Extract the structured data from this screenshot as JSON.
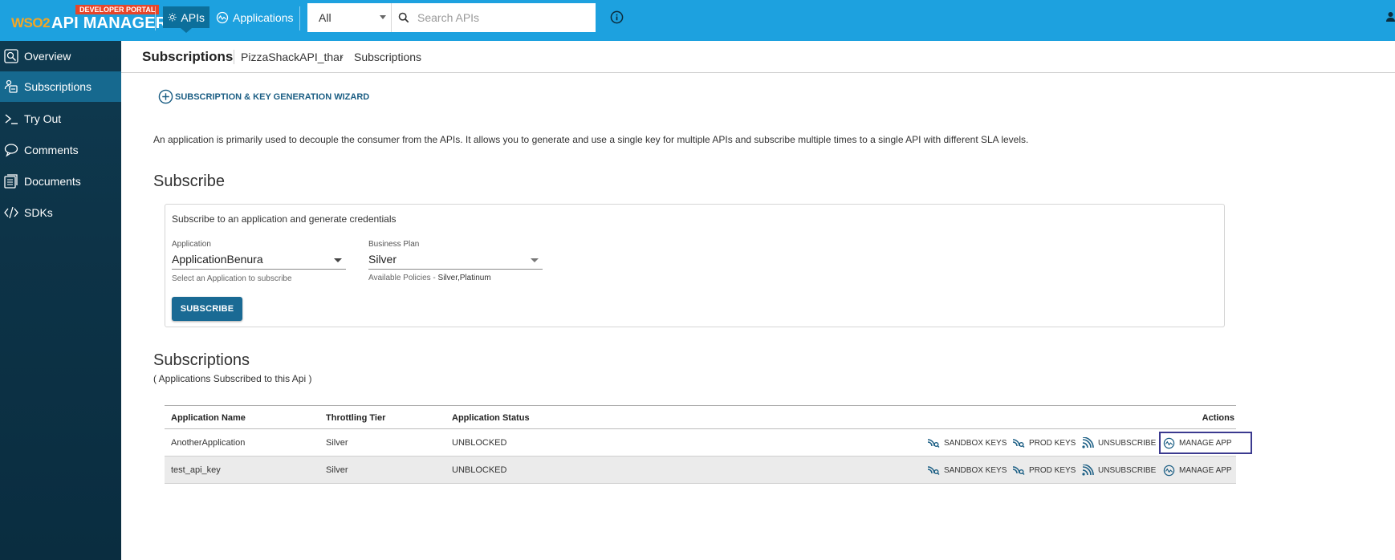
{
  "header": {
    "logo_prefix": "WSO2",
    "logo_title": "API MANAGER",
    "badge": "DEVELOPER PORTAL",
    "nav": [
      {
        "label": "APIs",
        "icon": "gear-icon",
        "active": true
      },
      {
        "label": "Applications",
        "icon": "applications-icon",
        "active": false
      }
    ],
    "search": {
      "scope": "All",
      "placeholder": "Search APIs"
    }
  },
  "sidebar": {
    "items": [
      {
        "label": "Overview",
        "icon": "overview-icon"
      },
      {
        "label": "Subscriptions",
        "icon": "subscriptions-icon",
        "active": true
      },
      {
        "label": "Try Out",
        "icon": "terminal-icon"
      },
      {
        "label": "Comments",
        "icon": "comment-icon"
      },
      {
        "label": "Documents",
        "icon": "documents-icon"
      },
      {
        "label": "SDKs",
        "icon": "code-icon"
      }
    ]
  },
  "page": {
    "title": "Subscriptions",
    "breadcrumb": [
      "PizzaShackAPI_thar",
      "Subscriptions"
    ],
    "wizard_label": "SUBSCRIPTION & KEY GENERATION WIZARD",
    "description": "An application is primarily used to decouple the consumer from the APIs. It allows you to generate and use a single key for multiple APIs and subscribe multiple times to a single API with different SLA levels."
  },
  "subscribe": {
    "heading": "Subscribe",
    "box_title": "Subscribe to an application and generate credentials",
    "application": {
      "label": "Application",
      "value": "ApplicationBenura",
      "help": "Select an Application to subscribe"
    },
    "plan": {
      "label": "Business Plan",
      "value": "Silver",
      "help_prefix": "Available Policies - ",
      "help_value": "Silver,Platinum"
    },
    "button": "SUBSCRIBE"
  },
  "subscriptions": {
    "heading": "Subscriptions",
    "subheading": "( Applications Subscribed to this Api )",
    "columns": [
      "Application Name",
      "Throttling Tier",
      "Application Status",
      "Actions"
    ],
    "rows": [
      {
        "name": "AnotherApplication",
        "tier": "Silver",
        "status": "UNBLOCKED"
      },
      {
        "name": "test_api_key",
        "tier": "Silver",
        "status": "UNBLOCKED"
      }
    ],
    "actions": {
      "sandbox": "SANDBOX KEYS",
      "prod": "PROD KEYS",
      "unsubscribe": "UNSUBSCRIBE",
      "manage": "MANAGE APP"
    }
  },
  "colors": {
    "topbar": "#1da1df",
    "sidebar": "#0d3347",
    "sidebar_active": "#16698f",
    "accent": "#1a6a94",
    "badge": "#e8462a"
  }
}
